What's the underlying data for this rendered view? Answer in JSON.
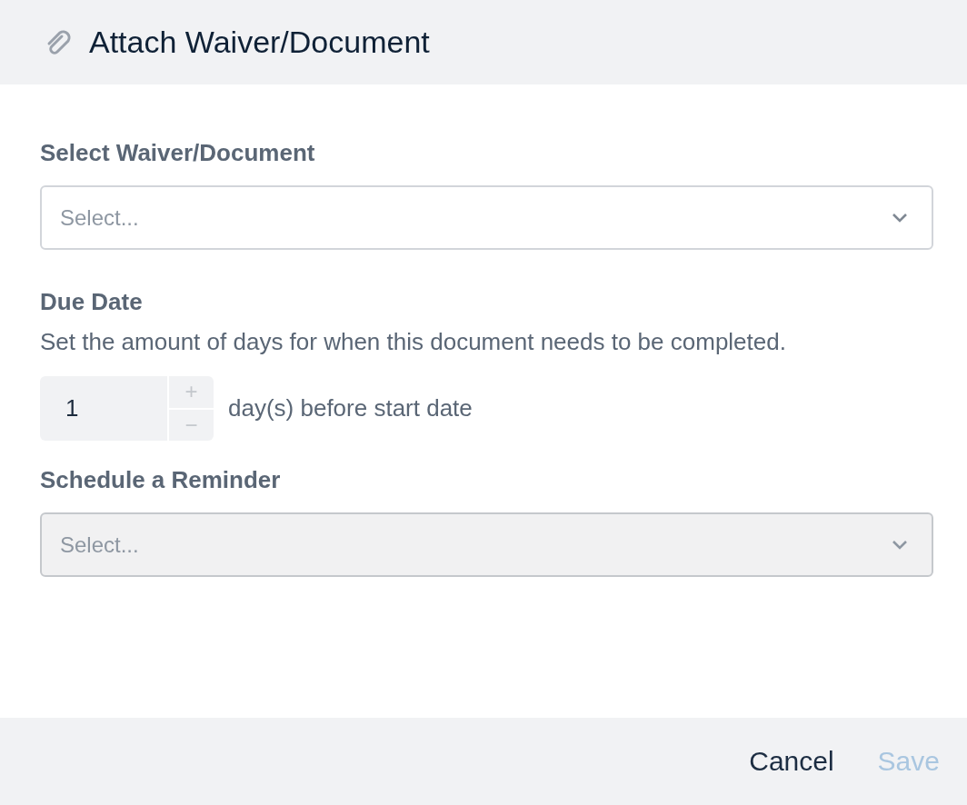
{
  "dialog": {
    "title": "Attach Waiver/Document"
  },
  "document_field": {
    "label": "Select Waiver/Document",
    "placeholder": "Select...",
    "disabled": false
  },
  "due_date": {
    "label": "Due Date",
    "description": "Set the amount of days for when this document needs to be completed.",
    "value": "1",
    "increment": "+",
    "decrement": "−",
    "suffix": "day(s) before start date"
  },
  "reminder_field": {
    "label": "Schedule a Reminder",
    "placeholder": "Select...",
    "disabled": true
  },
  "buttons": [
    {
      "label": "Cancel",
      "disabled": false
    },
    {
      "label": "Save",
      "disabled": true
    }
  ]
}
